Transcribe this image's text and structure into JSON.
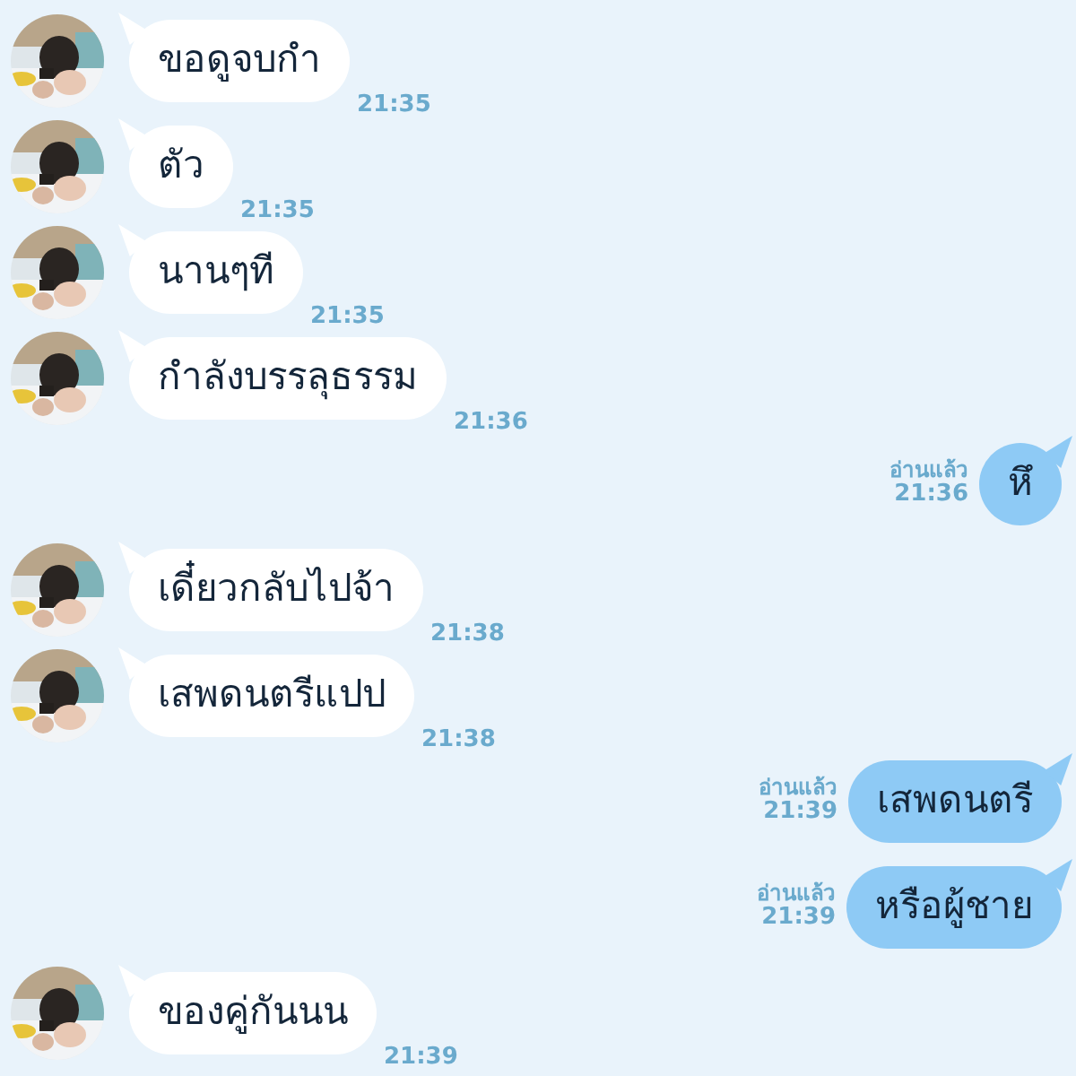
{
  "messages": [
    {
      "kind": "incoming",
      "text": "ขอดูจบกำ",
      "time": "21:35"
    },
    {
      "kind": "incoming",
      "text": "ตัว",
      "time": "21:35"
    },
    {
      "kind": "incoming",
      "text": "นานๆที",
      "time": "21:35"
    },
    {
      "kind": "incoming",
      "text": "กำลังบรรลุธรรม",
      "time": "21:36"
    },
    {
      "kind": "outgoing",
      "read_label": "อ่านแล้ว",
      "text": "หึ",
      "time": "21:36"
    },
    {
      "kind": "incoming",
      "text": "เดี๋ยวกลับไปจ้า",
      "time": "21:38"
    },
    {
      "kind": "incoming",
      "text": "เสพดนตรีแปป",
      "time": "21:38"
    },
    {
      "kind": "outgoing",
      "read_label": "อ่านแล้ว",
      "text": "เสพดนตรี",
      "time": "21:39"
    },
    {
      "kind": "outgoing",
      "read_label": "อ่านแล้ว",
      "text": "หรือผู้ชาย",
      "time": "21:39"
    },
    {
      "kind": "incoming",
      "text": "ของคู่กันนน",
      "time": "21:39"
    }
  ]
}
